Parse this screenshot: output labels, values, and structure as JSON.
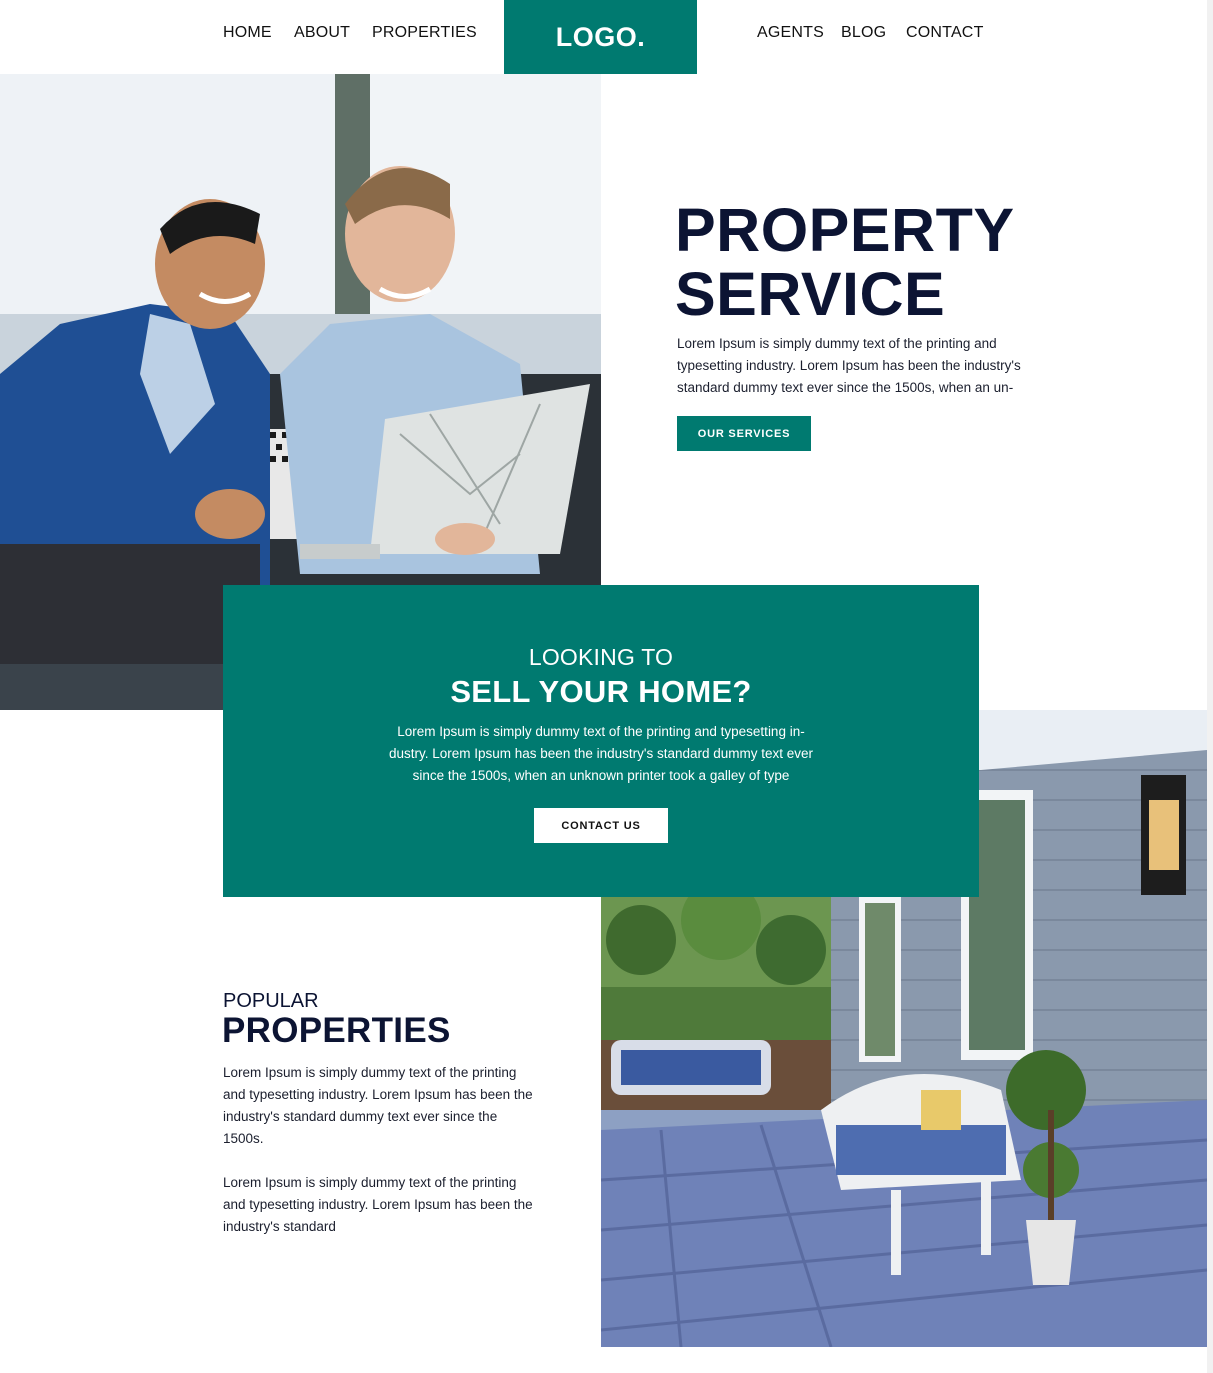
{
  "nav": {
    "left": [
      "HOME",
      "ABOUT",
      "PROPERTIES"
    ],
    "right": [
      "AGENTS",
      "BLOG",
      "CONTACT"
    ],
    "logo": "LOGO."
  },
  "hero": {
    "title_line1": "PROPERTY",
    "title_line2": "SERVICE",
    "description": "Lorem Ipsum is simply dummy text of the printing and typesetting industry. Lorem Ipsum has been the industry's standard dummy text ever since the 1500s, when an un-",
    "button": "OUR SERVICES"
  },
  "cta": {
    "subtitle": "LOOKING TO",
    "title": "SELL YOUR HOME?",
    "description": "Lorem Ipsum is simply dummy text of the printing and typesetting in-dustry. Lorem Ipsum has been the industry's standard dummy text ever since the 1500s, when an unknown printer took a galley of type",
    "button": "CONTACT US"
  },
  "popular": {
    "subtitle": "POPULAR",
    "title": "PROPERTIES",
    "paragraph1": "Lorem Ipsum is simply dummy text of the printing and typesetting industry. Lorem Ipsum has been the industry's standard dummy text ever since the 1500s.",
    "paragraph2": "Lorem Ipsum is simply dummy text of the printing and typesetting industry. Lorem Ipsum has been the industry's standard"
  },
  "colors": {
    "accent": "#007a70",
    "heading": "#0c1433",
    "background": "#ffffff"
  },
  "icons": {
    "hero_image": "business-meeting-photo",
    "porch_image": "house-porch-photo"
  }
}
